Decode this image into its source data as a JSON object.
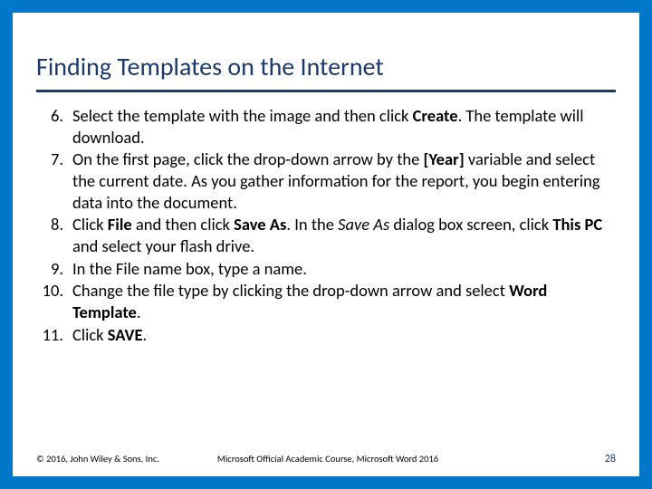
{
  "title": "Finding Templates on the Internet",
  "items": [
    {
      "num": "6.",
      "html": "Select the template with the image and then click <b>Create</b>. The template will download."
    },
    {
      "num": "7.",
      "html": "On the first page, click the drop-down arrow by the <b>[Year]</b> variable and select the current date. As you gather information for the report, you begin entering data into the document."
    },
    {
      "num": "8.",
      "html": "Click <b>File</b> and then click <b>Save As</b>. In the <i>Save As</i> dialog box screen, click <b>This PC</b> and select your flash drive."
    },
    {
      "num": "9.",
      "html": "In the File name box, type a name."
    },
    {
      "num": "10.",
      "html": "Change the file type by clicking the drop-down arrow and select <b>Word Template</b>."
    },
    {
      "num": "11.",
      "html": "Click <b>SAVE</b>."
    }
  ],
  "footer": {
    "copyright": "© 2016, John Wiley & Sons, Inc.",
    "course": "Microsoft Official Academic Course, Microsoft Word 2016",
    "page": "28"
  }
}
